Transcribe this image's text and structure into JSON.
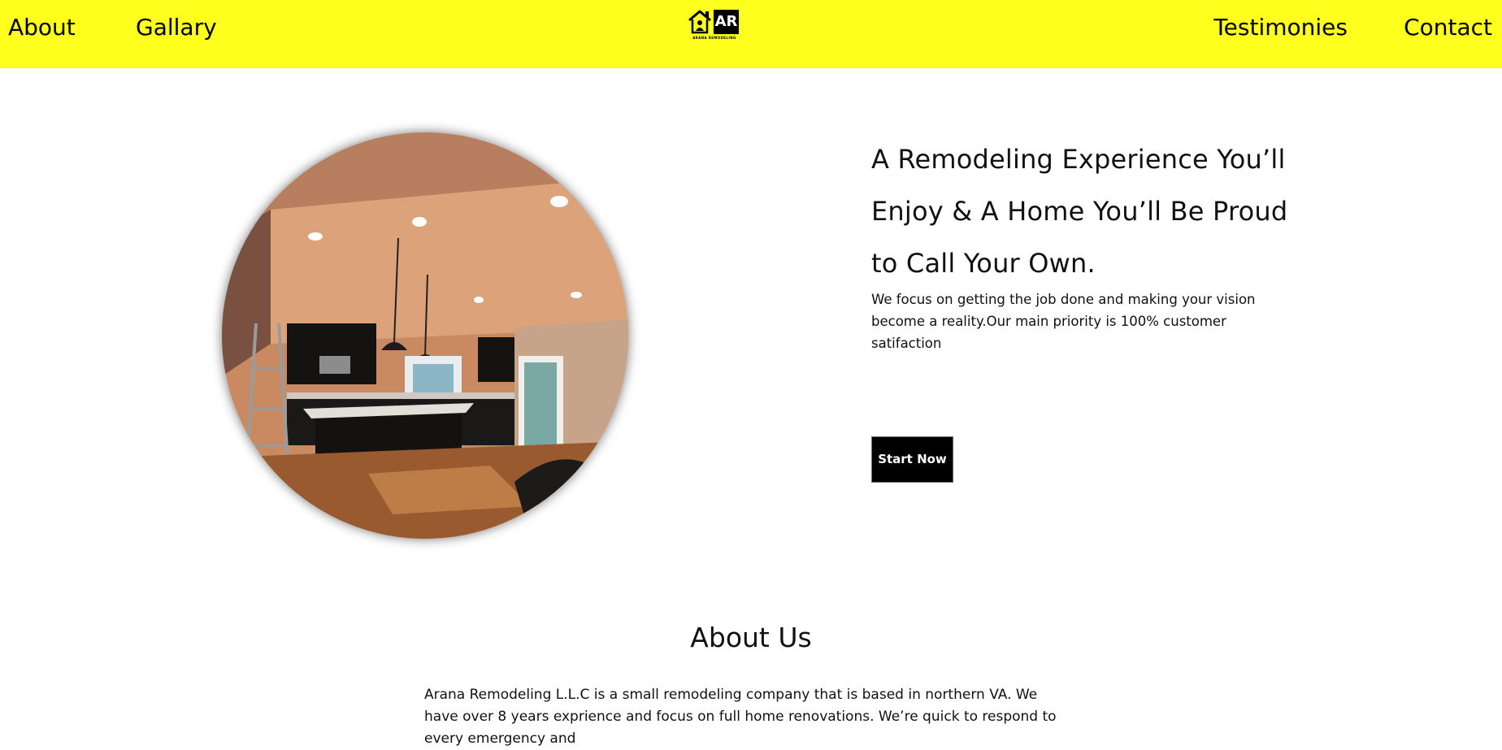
{
  "nav": {
    "about": "About",
    "gallary": "Gallary",
    "testimonies": "Testimonies",
    "contact": "Contact",
    "bg_color": "#ffff1e"
  },
  "logo": {
    "mark": "AR",
    "subtitle": "ARANA REMODELING",
    "icon": "house-icon"
  },
  "hero": {
    "title": "A Remodeling Experience You’ll Enjoy & A Home You’ll Be Proud to Call Your Own.",
    "description": "We focus on getting the job done and making your vision become a reality.Our main priority is 100% customer satifaction",
    "button_label": "Start Now",
    "image": "kitchen-photo"
  },
  "about": {
    "title": "About Us",
    "text": "Arana Remodeling L.L.C is a small remodeling company that is based in northern VA. We have over 8 years exprience and focus on full home renovations. We’re quick to respond to every emergency and"
  }
}
